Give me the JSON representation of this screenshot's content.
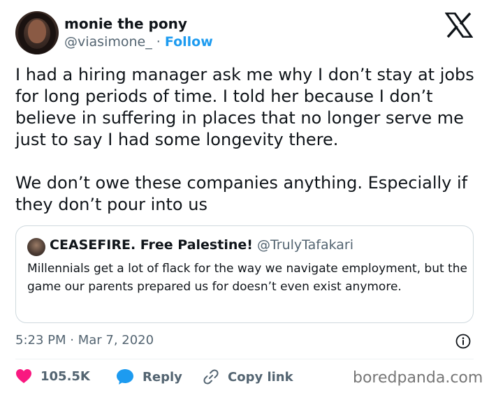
{
  "author": {
    "display_name": "monie the pony",
    "handle": "@viasimone_",
    "separator": "·",
    "follow_label": "Follow"
  },
  "tweet": {
    "paragraph_1": "I had a hiring manager ask me why I don’t stay at jobs for long periods of time. I told her because I don’t believe in suffering in places that no longer serve me just to say I had some longevity there.",
    "paragraph_2": "We don’t owe these companies anything. Especially if they don’t pour into us"
  },
  "quote": {
    "display_name": "CEASEFIRE. Free Palestine!",
    "handle": "@TrulyTafakari",
    "text": "Millennials get a lot of flack for the way we navigate employment, but the game our parents prepared us for doesn’t even exist anymore."
  },
  "meta": {
    "timestamp": "5:23 PM · Mar 7, 2020"
  },
  "actions": {
    "like_count": "105.5K",
    "reply_label": "Reply",
    "copy_link_label": "Copy link"
  },
  "watermark": "boredpanda.com",
  "colors": {
    "accent": "#1d9bf0",
    "like": "#f91880",
    "muted_text": "#536471",
    "border": "#cfd9de"
  },
  "icons": [
    "x-logo-icon",
    "info-icon",
    "heart-icon",
    "reply-bubble-icon",
    "link-icon"
  ]
}
